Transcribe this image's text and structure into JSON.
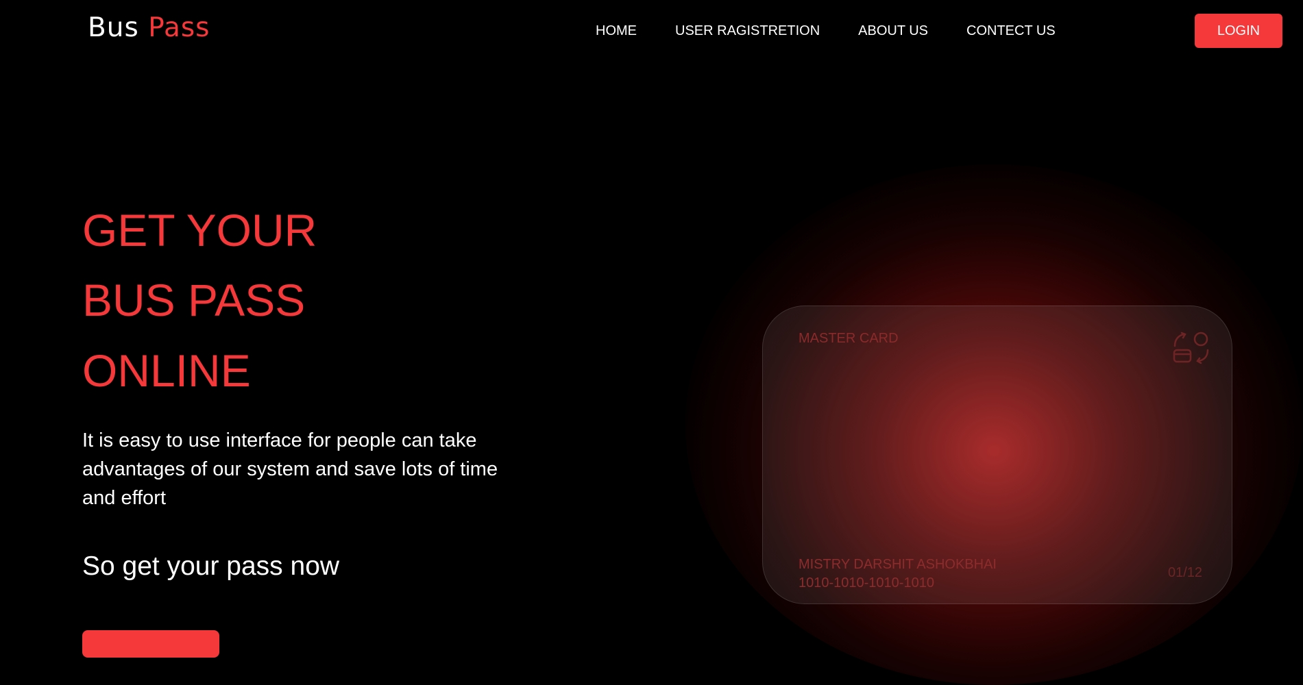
{
  "brand": {
    "part1": "Bus",
    "part2": "Pass"
  },
  "nav": {
    "home": "HOME",
    "registration": "USER RAGISTRETION",
    "about": "ABOUT US",
    "contact": "CONTECT US"
  },
  "login_label": "LOGIN",
  "hero": {
    "line1": "GET YOUR",
    "line2": "BUS PASS",
    "line3": "ONLINE",
    "description": "It is easy to use interface for people can take advantages of our system and save lots of time and effort",
    "cta_text": "So get your pass now"
  },
  "card": {
    "brand": "MASTER CARD",
    "icon": "card-exchange-icon",
    "holder": "MISTRY DARSHIT ASHOKBHAI",
    "number": "1010-1010-1010-1010",
    "expiry": "01/12"
  },
  "colors": {
    "accent": "#f5383a",
    "background": "#000000"
  }
}
